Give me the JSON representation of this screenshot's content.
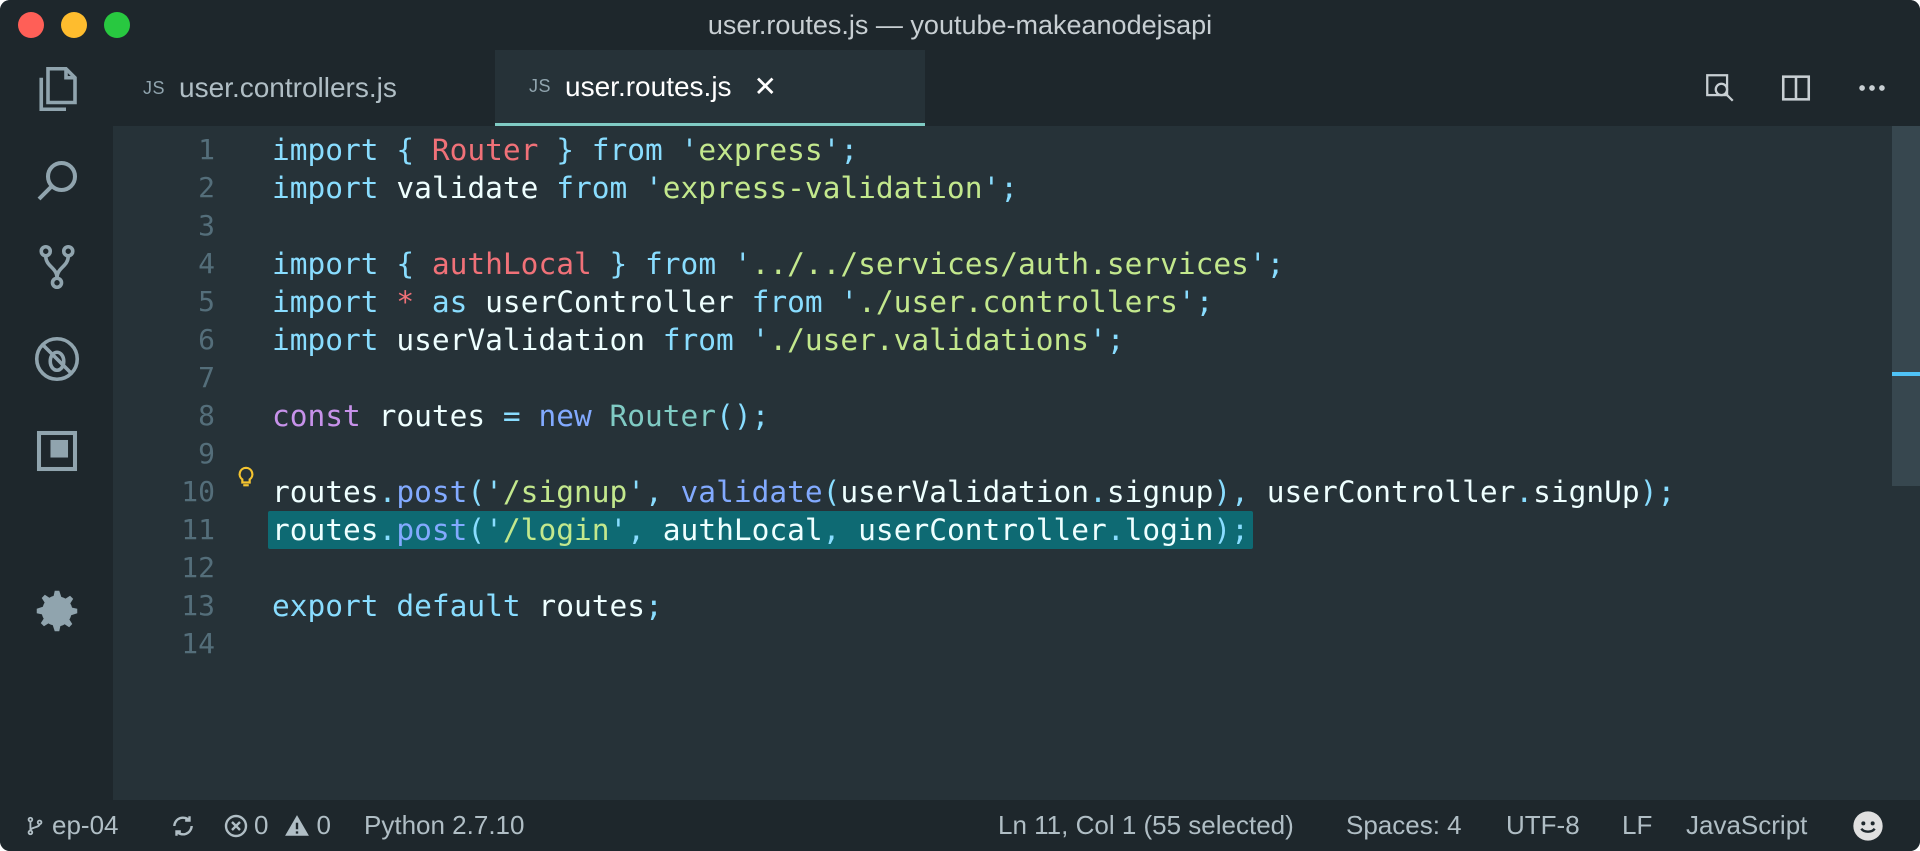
{
  "window": {
    "title": "user.routes.js — youtube-makeanodejsapi"
  },
  "tabs": [
    {
      "lang": "JS",
      "label": "user.controllers.js",
      "active": false
    },
    {
      "lang": "JS",
      "label": "user.routes.js",
      "active": true,
      "close": "✕"
    }
  ],
  "activity_bar": [
    "files-icon",
    "search-icon",
    "source-control-icon",
    "debug-icon",
    "extensions-icon",
    "gear-icon"
  ],
  "editor": {
    "line_numbers": [
      "1",
      "2",
      "3",
      "4",
      "5",
      "6",
      "7",
      "8",
      "9",
      "10",
      "11",
      "12",
      "13",
      "14"
    ],
    "lines": [
      "import { Router } from 'express';",
      "import validate from 'express-validation';",
      "",
      "import { authLocal } from '../../services/auth.services';",
      "import * as userController from './user.controllers';",
      "import userValidation from './user.validations';",
      "",
      "const routes = new Router();",
      "",
      "routes.post('/signup', validate(userValidation.signup), userController.signUp);",
      "routes.post('/login', authLocal, userController.login);",
      "",
      "export default routes;",
      ""
    ],
    "selected_line": 11
  },
  "status": {
    "branch": "ep-04",
    "errors": "0",
    "warnings": "0",
    "python": "Python 2.7.10",
    "position": "Ln 11, Col 1 (55 selected)",
    "spaces": "Spaces: 4",
    "encoding": "UTF-8",
    "eol": "LF",
    "language": "JavaScript"
  },
  "colors": {
    "background": "#263238",
    "sidebar": "#1e272c",
    "selection": "#0e6a73",
    "keyword": "#89ddff",
    "string": "#c3e88d",
    "variable": "#f07178",
    "const": "#c792ea"
  }
}
